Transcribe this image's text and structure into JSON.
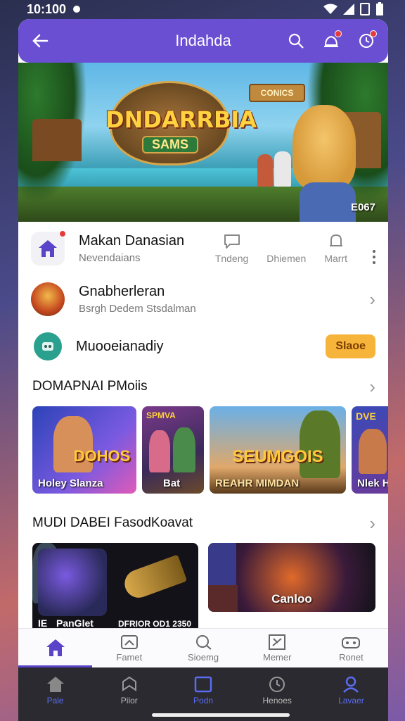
{
  "status": {
    "time": "10:100"
  },
  "header": {
    "title": "Indahda",
    "back_icon": "arrow-left-icon",
    "icons": [
      "search-icon",
      "notification-icon",
      "settings-icon"
    ]
  },
  "hero": {
    "logo_title": "DNDARRBIA",
    "logo_sub": "SAMS",
    "sign": "CONICS",
    "corner_label": "E067"
  },
  "profile": {
    "title": "Makan Danasian",
    "subtitle": "Nevendaians",
    "actions": [
      {
        "label": "Tndeng",
        "icon": "chat-icon"
      },
      {
        "label": "Dhiemen",
        "icon": ""
      },
      {
        "label": "Marrt",
        "icon": "bell-icon"
      }
    ]
  },
  "game_row": {
    "title": "Gnabherleran",
    "subtitle": "Bsrgh Dedem Stsdalman"
  },
  "share_row": {
    "title": "Muooeianadiy",
    "button": "Slaoe"
  },
  "section1": {
    "title": "DOMAPNAI PMoiis",
    "cards": [
      {
        "big": "DOHOS",
        "caption": "Holey Slanza",
        "color": "#3a57c9"
      },
      {
        "big": "",
        "caption": "Bat",
        "color": "#6a2a5a"
      },
      {
        "big": "SEUMGOIS",
        "caption": "REAHR MIMDAN",
        "color": "#4a8ac9"
      },
      {
        "big": "",
        "caption": "Nlek H",
        "color": "#3a4aa9"
      }
    ],
    "card_tops": [
      "",
      "SPMVA",
      "",
      "DVE"
    ]
  },
  "section2": {
    "title": "MUDI DABEI FasodKoavat",
    "promos": [
      {
        "left": "IE",
        "mid": "PanGlet",
        "right": "DFRIOR OD1 2350"
      },
      {
        "center": "Canloo"
      }
    ]
  },
  "tabs": [
    {
      "label": "",
      "icon": "home-icon",
      "active": true
    },
    {
      "label": "Famet",
      "icon": "gift-icon"
    },
    {
      "label": "Sioemg",
      "icon": "search-icon"
    },
    {
      "label": "Memer",
      "icon": "calendar-icon"
    },
    {
      "label": "Ronet",
      "icon": "gamepad-icon"
    }
  ],
  "nav": [
    {
      "label": "Pale",
      "icon": "home-icon"
    },
    {
      "label": "Pilor",
      "icon": "map-icon"
    },
    {
      "label": "Podn",
      "icon": "square-icon"
    },
    {
      "label": "Henoes",
      "icon": "clock-icon"
    },
    {
      "label": "Lavaer",
      "icon": "user-icon"
    }
  ]
}
